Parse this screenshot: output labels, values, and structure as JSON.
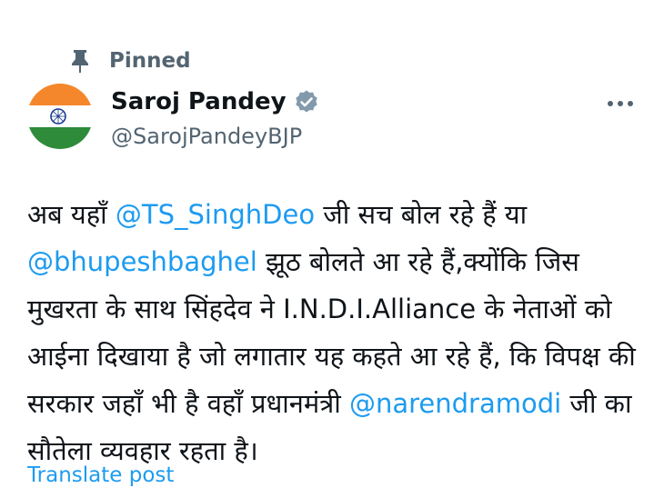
{
  "pinned": {
    "label": "Pinned"
  },
  "author": {
    "name": "Saroj Pandey",
    "handle": "@SarojPandeyBJP",
    "verified": true
  },
  "post": {
    "lines": [
      {
        "before": "अब यहाँ ",
        "mention": "@TS_SinghDeo",
        "after": " जी सच बोल रहे हैं या"
      },
      {
        "before": "",
        "mention": "@bhupeshbaghel",
        "after": " झूठ बोलते आ रहे हैं,क्योंकि जिस"
      },
      {
        "before": "मुखरता के साथ सिंहदेव ने I.N.D.I.Alliance के नेताओं को",
        "mention": "",
        "after": ""
      },
      {
        "before": "आईना दिखाया है जो लगातार यह कहते आ रहे हैं, कि विपक्ष की",
        "mention": "",
        "after": ""
      },
      {
        "before": "सरकार जहाँ भी है वहाँ  प्रधानमंत्री ",
        "mention": "@narendramodi",
        "after": " जी का"
      },
      {
        "before": "सौतेला व्यवहार रहता है।",
        "mention": "",
        "after": ""
      }
    ]
  },
  "translate": {
    "label": "Translate post"
  },
  "colors": {
    "accent": "#1d9bf0",
    "secondary_text": "#536471",
    "primary_text": "#0f1419",
    "saffron": "#f4872b",
    "flag_green": "#2e8b3a",
    "chakra_blue": "#1a3c8f"
  },
  "icons": {
    "pin": "pin-icon",
    "verified": "verified-badge-icon",
    "more": "more-horizontal-icon"
  }
}
